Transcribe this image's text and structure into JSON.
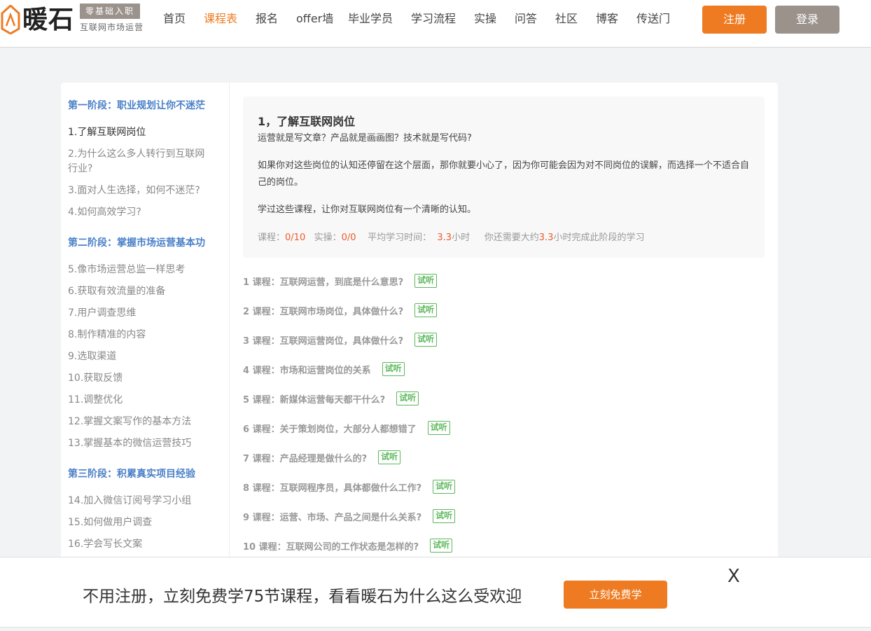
{
  "header": {
    "logo_name": "暖石",
    "logo_tag": "零基础入职",
    "logo_sub": "互联网市场运营",
    "nav": [
      {
        "label": "首页",
        "active": false
      },
      {
        "label": "课程表",
        "active": true
      },
      {
        "label": "报名",
        "active": false
      },
      {
        "label": "offer墙",
        "active": false
      },
      {
        "label": "毕业学员",
        "active": false
      },
      {
        "label": "学习流程",
        "active": false
      },
      {
        "label": "实操",
        "active": false
      },
      {
        "label": "问答",
        "active": false
      },
      {
        "label": "社区",
        "active": false
      },
      {
        "label": "博客",
        "active": false
      },
      {
        "label": "传送门",
        "active": false
      }
    ],
    "register_label": "注册",
    "login_label": "登录"
  },
  "sidebar": {
    "stages": [
      "第一阶段：职业规划让你不迷茫",
      "第二阶段：掌握市场运营基本功",
      "第三阶段：积累真实项目经验"
    ],
    "lessons": [
      "1.了解互联网岗位",
      "2.为什么这么多人转行到互联网行业?",
      "3.面对人生选择，如何不迷茫?",
      "4.如何高效学习?",
      "5.像市场运营总监一样思考",
      "6.获取有效流量的准备",
      "7.用户调查思维",
      "8.制作精准的内容",
      "9.选取渠道",
      "10.获取反馈",
      "11.调整优化",
      "12.掌握文案写作的基本方法",
      "13.掌握基本的微信运营技巧",
      "14.加入微信订阅号学习小组",
      "15.如何做用户调查",
      "16.学会写长文案"
    ]
  },
  "intro": {
    "title": "1，了解互联网岗位",
    "p1": "运营就是写文章？产品就是画画图？技术就是写代码?",
    "p2": "如果你对这些岗位的认知还停留在这个层面，那你就要小心了，因为你可能会因为对不同岗位的误解，而选择一个不适合自己的岗位。",
    "p3": "学过这些课程，让你对互联网岗位有一个清晰的认知。",
    "stats": {
      "course_label": "课程：",
      "course_value": "0/10",
      "practice_label": "实操：",
      "practice_value": "0/0",
      "avg_label": "平均学习时间：",
      "avg_value": "3.3",
      "hours": "小时",
      "remain_pre": "你还需要大约",
      "remain_value": "3.3",
      "remain_post": "小时完成此阶段的学习"
    }
  },
  "courses": [
    "1 课程：互联网运营，到底是什么意思?",
    "2 课程：互联网市场岗位，具体做什么?",
    "3 课程：互联网运营岗位，具体做什么?",
    "4 课程：市场和运营岗位的关系",
    "5 课程：新媒体运营每天都干什么?",
    "6 课程：关于策划岗位，大部分人都想错了",
    "7 课程：产品经理是做什么的?",
    "8 课程：互联网程序员，具体都做什么工作?",
    "9 课程：运营、市场、产品之间是什么关系?",
    "10 课程：互联网公司的工作状态是怎样的?"
  ],
  "trial_label": "试听",
  "promo": {
    "text": "不用注册，立刻免费学75节课程，看看暖石为什么这么受欢迎",
    "button": "立刻免费学",
    "close": "X"
  },
  "colors": {
    "accent": "#ee7b22",
    "stage_blue": "#4a80c8",
    "trial_green": "#5cb85c",
    "highlight_red": "#ee5a2a"
  }
}
